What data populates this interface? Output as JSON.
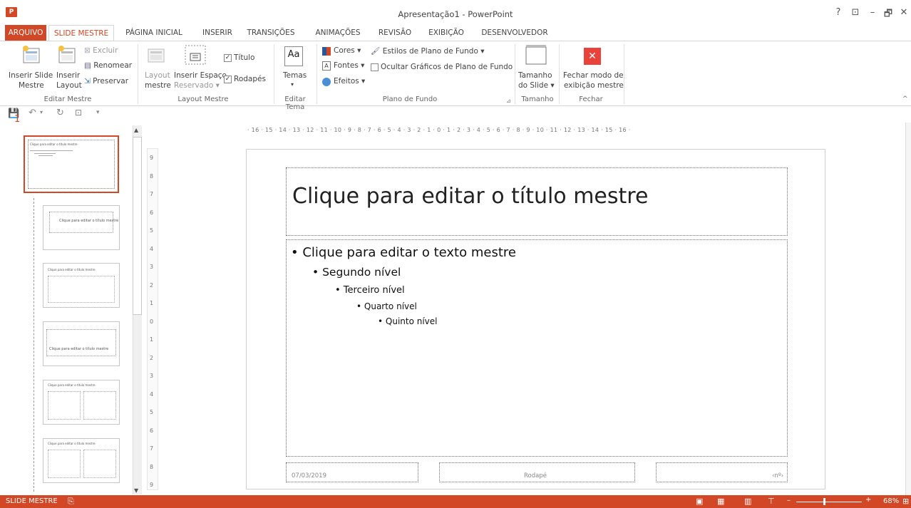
{
  "app": {
    "icon_text": "P",
    "title": "Apresentação1 - PowerPoint"
  },
  "window": {
    "help": "?",
    "ribbon_opts": "⊡",
    "minimize": "–",
    "restore": "🗗",
    "close": "✕"
  },
  "tabs": [
    {
      "label": "ARQUIVO"
    },
    {
      "label": "SLIDE MESTRE"
    },
    {
      "label": "PÁGINA INICIAL"
    },
    {
      "label": "INSERIR"
    },
    {
      "label": "TRANSIÇÕES"
    },
    {
      "label": "ANIMAÇÕES"
    },
    {
      "label": "REVISÃO"
    },
    {
      "label": "EXIBIÇÃO"
    },
    {
      "label": "DESENVOLVEDOR"
    }
  ],
  "ribbon": {
    "editar_mestre": {
      "label": "Editar Mestre",
      "inserir_slide_mestre": [
        "Inserir Slide",
        "Mestre"
      ],
      "inserir_layout": [
        "Inserir",
        "Layout"
      ],
      "excluir": "Excluir",
      "renomear": "Renomear",
      "preservar": "Preservar"
    },
    "layout_mestre": {
      "label": "Layout Mestre",
      "layout_mestre": [
        "Layout",
        "mestre"
      ],
      "inserir_espaco": [
        "Inserir Espaço",
        "Reservado ▾"
      ],
      "titulo": "Título",
      "rodapes": "Rodapés"
    },
    "editar_tema": {
      "label": "Editar Tema",
      "temas": "Temas",
      "temas_arrow": "▾"
    },
    "plano_de_fundo": {
      "label": "Plano de Fundo",
      "cores": "Cores ▾",
      "fontes": "Fontes ▾",
      "efeitos": "Efeitos ▾",
      "estilos": "Estilos de Plano de Fundo ▾",
      "ocultar": "Ocultar Gráficos de Plano de Fundo"
    },
    "tamanho": {
      "label": "Tamanho",
      "btn": [
        "Tamanho",
        "do Slide ▾"
      ]
    },
    "fechar": {
      "label": "Fechar",
      "btn": [
        "Fechar modo de",
        "exibição mestre"
      ]
    }
  },
  "thumbnails": {
    "number": "1",
    "thumb1_title": "Clique para editar o título mestre",
    "thumb2_title": "Clique para editar o título mestre",
    "thumb3_title": "Clique para editar o título mestre",
    "thumb4_title": "Clique para editar o título mestre",
    "thumb5_title": "Clique para editar o título mestre",
    "thumb6_title": "Clique para editar o título mestre"
  },
  "ruler": {
    "h": "· 16 · 15 · 14 · 13 · 12 · 11 · 10 · 9 · 8 · 7 · 6 · 5 · 4 · 3 · 2 · 1 · 0 · 1 · 2 · 3 · 4 · 5 · 6 · 7 · 8 · 9 · 10 · 11 · 12 · 13 · 14 · 15 · 16 ·",
    "v": [
      "9",
      "8",
      "7",
      "6",
      "5",
      "4",
      "3",
      "2",
      "1",
      "0",
      "1",
      "2",
      "3",
      "4",
      "5",
      "6",
      "7",
      "8",
      "9"
    ]
  },
  "slide": {
    "title": "Clique para editar o título mestre",
    "lvl1": "• Clique para editar o texto mestre",
    "lvl2": "• Segundo nível",
    "lvl3": "• Terceiro nível",
    "lvl4": "• Quarto nível",
    "lvl5": "• Quinto nível",
    "date": "07/03/2019",
    "footer": "Rodapé",
    "number": "‹nº›"
  },
  "status": {
    "mode": "SLIDE MESTRE",
    "zoom": "68%"
  },
  "colors": {
    "accent": "#d24726",
    "close_red": "#e8423a"
  }
}
